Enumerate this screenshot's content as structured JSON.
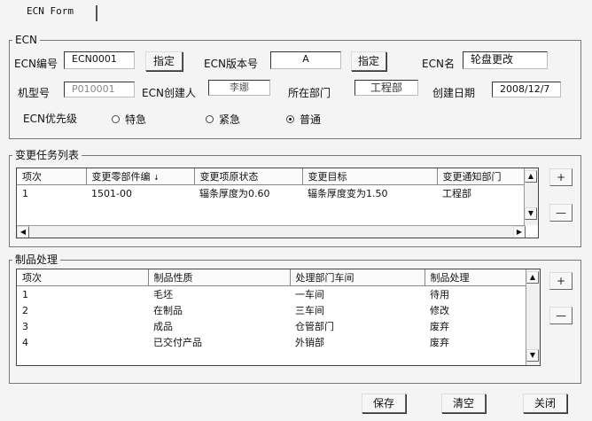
{
  "window": {
    "tab_title": "ECN Form"
  },
  "ecn": {
    "group_label": "ECN",
    "ecn_no_label": "ECN编号",
    "ecn_no_value": "ECN0001",
    "assign1_label": "指定",
    "version_label": "ECN版本号",
    "version_value": "A",
    "assign2_label": "指定",
    "name_label": "ECN名",
    "name_value": "轮盘更改",
    "model_label": "机型号",
    "model_value": "P010001",
    "creator_label": "ECN创建人",
    "creator_value": "李娜",
    "dept_label": "所在部门",
    "dept_value": "工程部",
    "date_label": "创建日期",
    "date_value": "2008/12/7",
    "priority_label": "ECN优先级",
    "priority_options": [
      "特急",
      "紧急",
      "普通"
    ],
    "priority_selected": "普通"
  },
  "tasks": {
    "group_label": "变更任务列表",
    "columns": [
      "项次",
      "变更零部件编",
      "变更项原状态",
      "变更目标",
      "变更通知部门"
    ],
    "rows": [
      [
        "1",
        "1501-00",
        "辐条厚度为0.60",
        "辐条厚度变为1.50",
        "工程部"
      ]
    ],
    "add_label": "+",
    "remove_label": "—"
  },
  "products": {
    "group_label": "制品处理",
    "columns": [
      "项次",
      "制品性质",
      "处理部门车间",
      "制品处理"
    ],
    "rows": [
      [
        "1",
        "毛坯",
        "一车间",
        "待用"
      ],
      [
        "2",
        "在制品",
        "三车间",
        "修改"
      ],
      [
        "3",
        "成品",
        "仓管部门",
        "废弃"
      ],
      [
        "4",
        "已交付产品",
        "外销部",
        "废弃"
      ]
    ],
    "add_label": "+",
    "remove_label": "—"
  },
  "footer": {
    "save_label": "保存",
    "clear_label": "清空",
    "close_label": "关闭"
  },
  "icons": {
    "scroll_up": "scroll-up-icon",
    "scroll_down": "scroll-down-icon",
    "scroll_left": "scroll-left-icon",
    "scroll_right": "scroll-right-icon",
    "sort": "sort-icon"
  }
}
